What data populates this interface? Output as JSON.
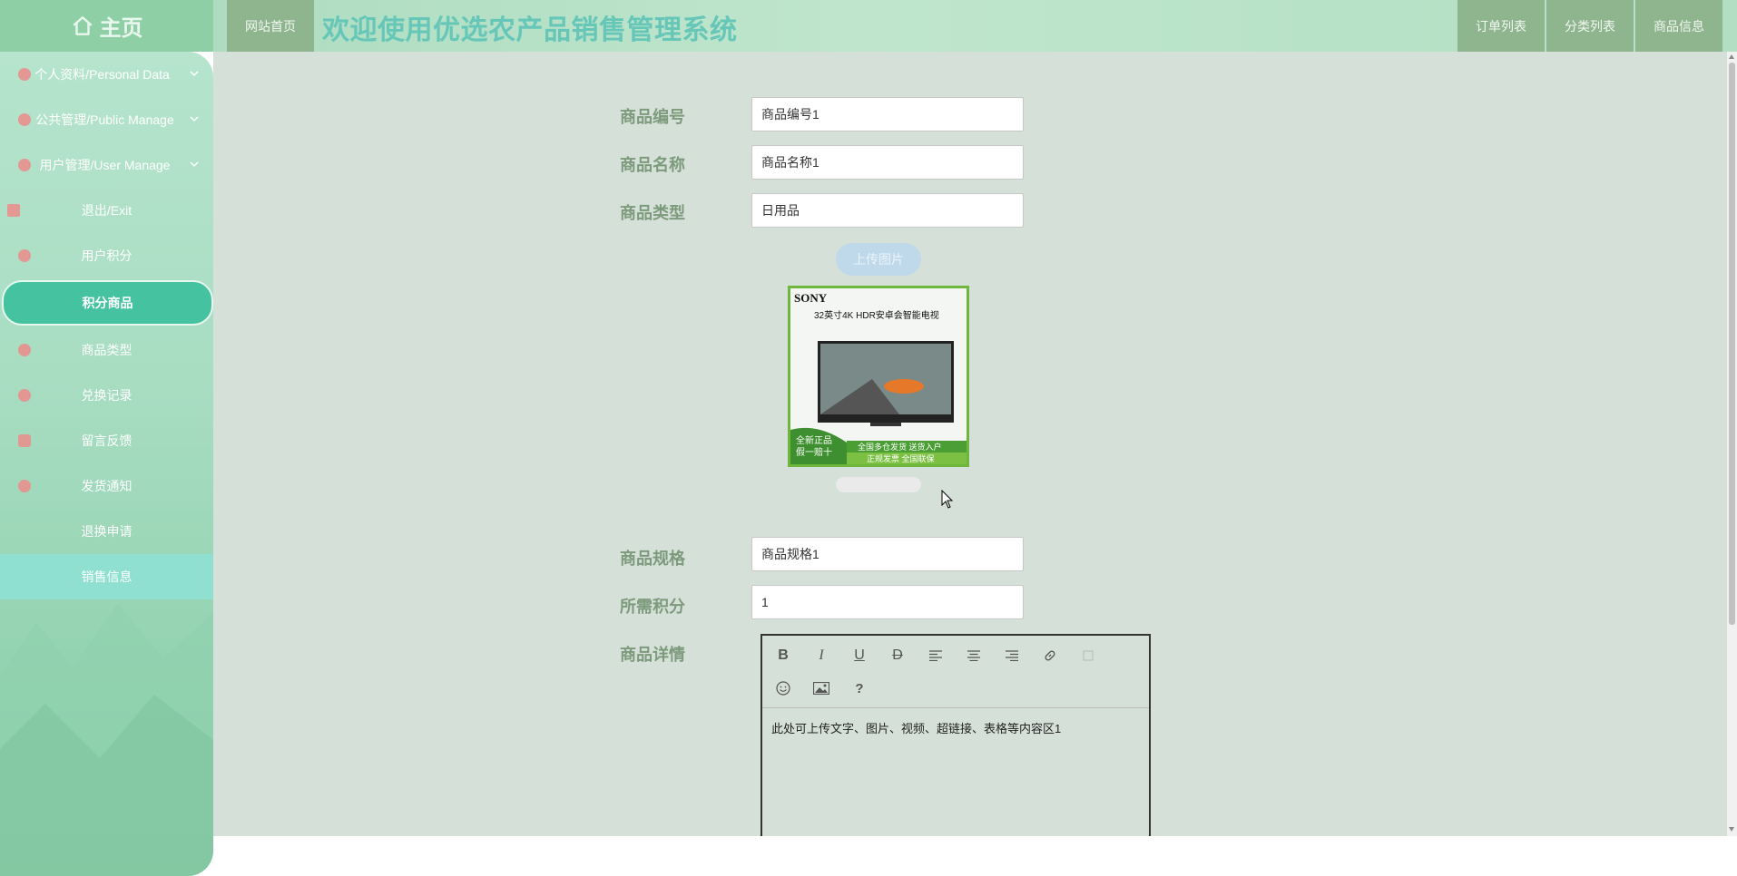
{
  "header": {
    "home_label": "主页",
    "site_home": "网站首页",
    "title": "欢迎使用优选农产品销售管理系统",
    "right_buttons": [
      "订单列表",
      "分类列表",
      "商品信息"
    ]
  },
  "sidebar": {
    "items": [
      {
        "label": "个人资料/Personal Data"
      },
      {
        "label": "公共管理/Public Manage"
      },
      {
        "label": "用户管理/User Manage"
      },
      {
        "label": "退出/Exit"
      },
      {
        "label": "用户积分"
      },
      {
        "label": "积分商品"
      },
      {
        "label": "商品类型"
      },
      {
        "label": "兑换记录"
      },
      {
        "label": "留言反馈"
      },
      {
        "label": "发货通知"
      },
      {
        "label": "退换申请"
      },
      {
        "label": "销售信息"
      }
    ]
  },
  "form": {
    "product_no": {
      "label": "商品编号",
      "value": "商品编号1"
    },
    "product_name": {
      "label": "商品名称",
      "value": "商品名称1"
    },
    "product_type": {
      "label": "商品类型",
      "value": "日用品"
    },
    "upload_label": "上传图片",
    "image": {
      "brand": "SONY",
      "headline": "32英寸4K HDR安卓会智能电视",
      "badge_line1": "全新正品",
      "badge_line2": "假一赔十",
      "strip1": "全国多仓发货 送货入户",
      "strip2": "正规发票 全国联保"
    },
    "spec": {
      "label": "商品规格",
      "value": "商品规格1"
    },
    "points": {
      "label": "所需积分",
      "value": "1"
    },
    "details": {
      "label": "商品详情",
      "content": "此处可上传文字、图片、视频、超链接、表格等内容区1"
    }
  },
  "colors": {
    "accent": "#45c2a0",
    "title": "#66c7b9",
    "topnav": "#8eb58e"
  }
}
